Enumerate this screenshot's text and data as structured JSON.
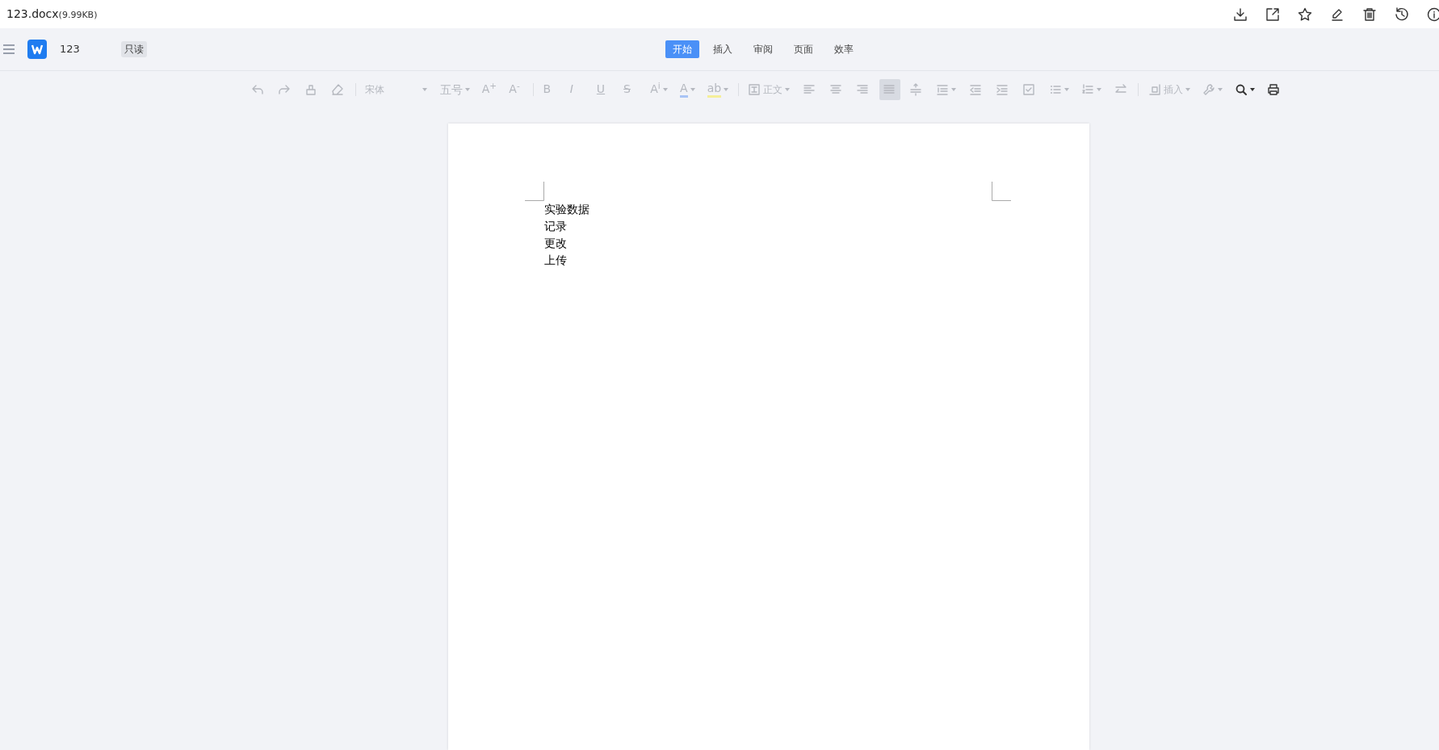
{
  "file": {
    "name": "123.docx",
    "size": "(9.99KB)"
  },
  "actions": [
    {
      "kind": "download"
    },
    {
      "kind": "share"
    },
    {
      "kind": "star"
    },
    {
      "kind": "edit"
    },
    {
      "kind": "delete"
    },
    {
      "kind": "history"
    },
    {
      "kind": "info"
    }
  ],
  "header": {
    "doc_title": "123",
    "badge": "只读"
  },
  "tabs": [
    {
      "label": "开始",
      "selected": true
    },
    {
      "label": "插入",
      "selected": false
    },
    {
      "label": "审阅",
      "selected": false
    },
    {
      "label": "页面",
      "selected": false
    },
    {
      "label": "效率",
      "selected": false
    }
  ],
  "toolbar": [
    {
      "kind": "undo",
      "disabled": true,
      "selected": false
    },
    {
      "kind": "redo",
      "disabled": true,
      "selected": false
    },
    {
      "kind": "painter",
      "disabled": true,
      "selected": false
    },
    {
      "kind": "eraser",
      "disabled": true,
      "selected": false
    },
    {
      "kind": "separator"
    },
    {
      "kind": "select",
      "label": "宋体",
      "disabled": true,
      "wide": true
    },
    {
      "kind": "select",
      "label": "五号",
      "disabled": true,
      "wide": false
    },
    {
      "kind": "grow",
      "label": "A$^{+}$",
      "disabled": true,
      "selected": false
    },
    {
      "kind": "shrink",
      "label": "A$^{-}$",
      "disabled": true,
      "selected": false
    },
    {
      "kind": "separator"
    },
    {
      "kind": "bold",
      "label": "B",
      "disabled": true,
      "selected": false
    },
    {
      "kind": "italic",
      "label": "I",
      "disabled": true,
      "selected": false
    },
    {
      "kind": "underline",
      "label": "U",
      "disabled": true,
      "selected": false
    },
    {
      "kind": "strike",
      "label": "S",
      "disabled": true,
      "selected": false
    },
    {
      "kind": "superscript",
      "label": "A$^{i}$",
      "disabled": true,
      "selected": false,
      "menu": true
    },
    {
      "kind": "font-color",
      "label": "A",
      "disabled": true,
      "selected": false,
      "menu": true,
      "color": "#a9c4f5"
    },
    {
      "kind": "highlight",
      "label": "ab",
      "disabled": true,
      "selected": false,
      "menu": true,
      "color": "#f5ef9a"
    },
    {
      "kind": "separator"
    },
    {
      "kind": "style",
      "label": "正文",
      "disabled": true
    },
    {
      "kind": "align-left",
      "disabled": true,
      "selected": false
    },
    {
      "kind": "align-center",
      "disabled": true,
      "selected": false
    },
    {
      "kind": "align-right",
      "disabled": true,
      "selected": false
    },
    {
      "kind": "justify",
      "disabled": true,
      "selected": true
    },
    {
      "kind": "spacing",
      "disabled": true,
      "selected": false
    },
    {
      "kind": "para-spacing",
      "disabled": true,
      "selected": false,
      "menu": true
    },
    {
      "kind": "outdent",
      "disabled": true,
      "selected": false
    },
    {
      "kind": "indent",
      "disabled": true,
      "selected": false
    },
    {
      "kind": "checkbox",
      "disabled": true,
      "selected": false
    },
    {
      "kind": "bullets",
      "disabled": true,
      "selected": false,
      "menu": true
    },
    {
      "kind": "numbering",
      "disabled": true,
      "selected": false,
      "menu": true
    },
    {
      "kind": "direction",
      "disabled": true,
      "selected": false
    },
    {
      "kind": "separator"
    },
    {
      "kind": "insert",
      "label": "插入",
      "disabled": true
    },
    {
      "kind": "tools",
      "disabled": true,
      "selected": false,
      "menu": true
    },
    {
      "kind": "search",
      "disabled": false,
      "selected": false,
      "menu": true
    },
    {
      "kind": "print",
      "disabled": false,
      "selected": false
    }
  ],
  "document": {
    "lines": [
      "实验数据",
      "记录",
      "更改",
      "上传"
    ]
  }
}
